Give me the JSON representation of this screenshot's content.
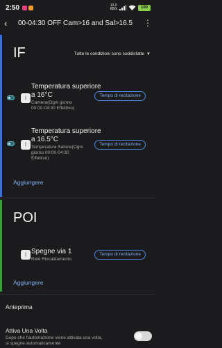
{
  "status_bar": {
    "time": "2:50",
    "net_speed_value": "13.0",
    "net_speed_unit": "KB/s",
    "battery": "100",
    "app_dot_colors": [
      "#e0427a",
      "#f29a2e"
    ]
  },
  "app_bar": {
    "title": "00-04:30 OFF Cam>16 and Sal>16.5"
  },
  "if_section": {
    "heading": "IF",
    "conditions_selector": "Tutte le condizioni sono soddisfatte",
    "accent_color": "#3f6fd6",
    "items": [
      {
        "title_line1": "Temperatura superiore",
        "title_line2": "a 16°C",
        "subtitle_line1": "Camera(Ogni giorno",
        "subtitle_line2": "00:00-04:30 Effettivo)",
        "button": "Tempo di recitazione"
      },
      {
        "title_line1": "Temperatura superiore",
        "title_line2": "a 16.5°C",
        "subtitle_line1": "Temperatura Salone(Ogni",
        "subtitle_line2": "giorno 00:00-04:30",
        "subtitle_line3": "Effettivo)",
        "button": "Tempo di recitazione"
      }
    ],
    "add_label": "Aggiungere"
  },
  "then_section": {
    "heading": "POI",
    "accent_color": "#3c9a3c",
    "items": [
      {
        "title": "Spegne via 1",
        "subtitle": "Relè Riscaldamento",
        "button": "Tempo di recitazione"
      }
    ],
    "add_label": "Aggiungere"
  },
  "preview": {
    "label": "Anteprima"
  },
  "run_once": {
    "label": "Attiva Una Volta",
    "description_line1": "Dopo che l'automazione viene attivata una volta,",
    "description_line2": "si spegne automaticamente",
    "enabled": false
  }
}
